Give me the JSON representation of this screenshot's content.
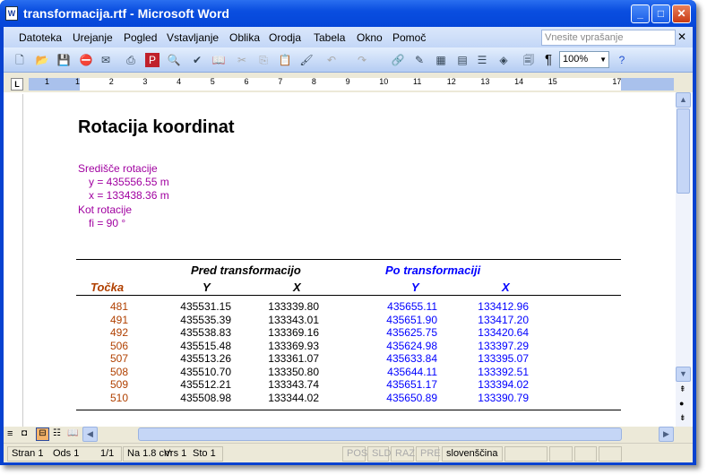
{
  "window": {
    "title": "transformacija.rtf - Microsoft Word"
  },
  "menu": [
    "Datoteka",
    "Urejanje",
    "Pogled",
    "Vstavljanje",
    "Oblika",
    "Orodja",
    "Tabela",
    "Okno",
    "Pomoč"
  ],
  "ask": {
    "placeholder": "Vnesite vprašanje"
  },
  "toolbar": {
    "zoom": "100%"
  },
  "ruler": [
    "1",
    "1",
    "2",
    "3",
    "4",
    "5",
    "6",
    "7",
    "8",
    "9",
    "10",
    "11",
    "12",
    "13",
    "14",
    "15",
    "17"
  ],
  "document": {
    "title": "Rotacija koordinat",
    "center_label": "Središče rotacije",
    "center_y": "y = 435556.55 m",
    "center_x": "x = 133438.36 m",
    "angle_label": "Kot rotacije",
    "angle": "fi = 90 °",
    "table": {
      "group_before": "Pred transformacijo",
      "group_after": "Po transformaciji",
      "headers": [
        "Točka",
        "Y",
        "X",
        "Y",
        "X"
      ],
      "rows": [
        [
          "481",
          "435531.15",
          "133339.80",
          "435655.11",
          "133412.96"
        ],
        [
          "491",
          "435535.39",
          "133343.01",
          "435651.90",
          "133417.20"
        ],
        [
          "492",
          "435538.83",
          "133369.16",
          "435625.75",
          "133420.64"
        ],
        [
          "506",
          "435515.48",
          "133369.93",
          "435624.98",
          "133397.29"
        ],
        [
          "507",
          "435513.26",
          "133361.07",
          "435633.84",
          "133395.07"
        ],
        [
          "508",
          "435510.70",
          "133350.80",
          "435644.11",
          "133392.51"
        ],
        [
          "509",
          "435512.21",
          "133343.74",
          "435651.17",
          "133394.02"
        ],
        [
          "510",
          "435508.98",
          "133344.02",
          "435650.89",
          "133390.79"
        ]
      ]
    }
  },
  "status": {
    "page": "Stran 1",
    "section": "Ods 1",
    "pages": "1/1",
    "at": "Na 1.8 cm",
    "line": "Vrs 1",
    "col": "Sto 1",
    "rec": "POS",
    "trk": "SLD",
    "ext": "RAZ",
    "ovr": "PRE",
    "lang": "slovenščina"
  },
  "colors": {
    "magenta": "#a000a0",
    "brown": "#b04000",
    "blue": "#0000ff"
  }
}
